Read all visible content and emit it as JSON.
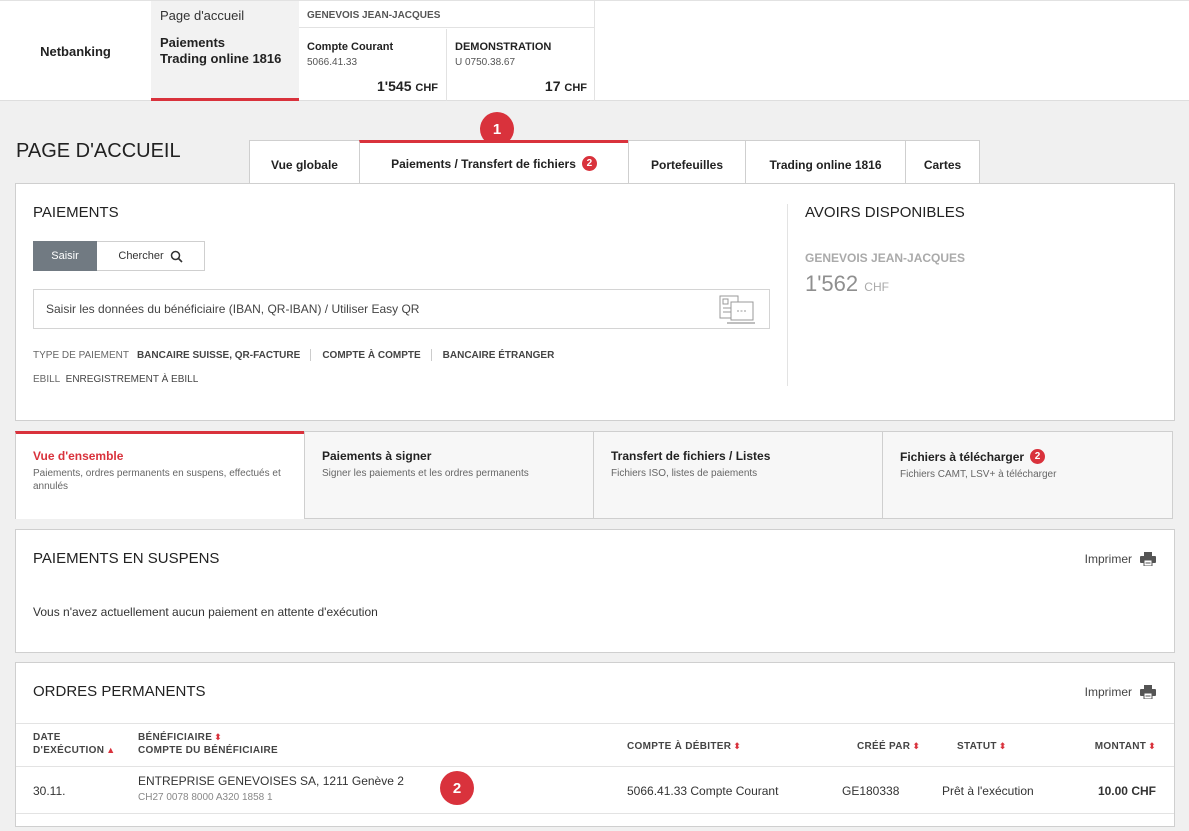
{
  "header": {
    "brand": "Netbanking",
    "nav": {
      "home": "Page d'accueil",
      "payments": "Paiements",
      "trading": "Trading online 1816"
    },
    "owner": "GENEVOIS JEAN-JACQUES",
    "accounts": [
      {
        "name": "Compte Courant",
        "number": "5066.41.33",
        "balance": "1'545",
        "currency": "CHF"
      },
      {
        "name": "DEMONSTRATION",
        "number": "U 0750.38.67",
        "balance": "17",
        "currency": "CHF"
      }
    ]
  },
  "page": {
    "title": "PAGE D'ACCUEIL",
    "tabs": [
      {
        "label": "Vue globale"
      },
      {
        "label": "Paiements / Transfert de fichiers",
        "badge": "2",
        "active": true
      },
      {
        "label": "Portefeuilles"
      },
      {
        "label": "Trading online 1816"
      },
      {
        "label": "Cartes"
      }
    ]
  },
  "callouts": [
    "1",
    "2"
  ],
  "payments": {
    "title": "PAIEMENTS",
    "seg_enter": "Saisir",
    "seg_search": "Chercher",
    "entry_placeholder": "Saisir les données du bénéficiaire (IBAN, QR-IBAN) / Utiliser Easy QR",
    "type_label": "TYPE DE PAIEMENT",
    "type_links": [
      "BANCAIRE SUISSE, QR-FACTURE",
      "COMPTE À COMPTE",
      "BANCAIRE ÉTRANGER"
    ],
    "ebill_label": "EBILL",
    "ebill_link": "ENREGISTREMENT À EBILL"
  },
  "assets": {
    "title": "AVOIRS DISPONIBLES",
    "owner": "GENEVOIS JEAN-JACQUES",
    "amount": "1'562",
    "currency": "CHF"
  },
  "subtabs": [
    {
      "title": "Vue d'ensemble",
      "desc": "Paiements, ordres permanents en suspens, effectués et annulés",
      "active": true
    },
    {
      "title": "Paiements à signer",
      "desc": "Signer les paiements et les ordres permanents"
    },
    {
      "title": "Transfert de fichiers / Listes",
      "desc": "Fichiers ISO, listes de paiements"
    },
    {
      "title": "Fichiers à télécharger",
      "desc": "Fichiers CAMT, LSV+ à télécharger",
      "badge": "2"
    }
  ],
  "pending": {
    "title": "PAIEMENTS EN SUSPENS",
    "print": "Imprimer",
    "message": "Vous n'avez actuellement aucun paiement en attente d'exécution"
  },
  "standing": {
    "title": "ORDRES PERMANENTS",
    "print": "Imprimer",
    "columns": {
      "date_1": "DATE",
      "date_2": "D'EXÉCUTION",
      "benef_1": "BÉNÉFICIAIRE",
      "benef_2": "COMPTE DU BÉNÉFICIAIRE",
      "debit": "COMPTE À DÉBITER",
      "created": "CRÉÉ PAR",
      "status": "STATUT",
      "amount": "MONTANT"
    },
    "rows": [
      {
        "date": "30.11.",
        "beneficiary": "ENTREPRISE GENEVOISES SA, 1211 Genève 2",
        "iban": "CH27 0078 8000 A320 1858 1",
        "debit": "5066.41.33 Compte Courant",
        "created_by": "GE180338",
        "status": "Prêt à l'exécution",
        "amount": "10.00",
        "currency": "CHF"
      }
    ]
  },
  "colors": {
    "accent": "#d9323c",
    "segment": "#717a82"
  }
}
